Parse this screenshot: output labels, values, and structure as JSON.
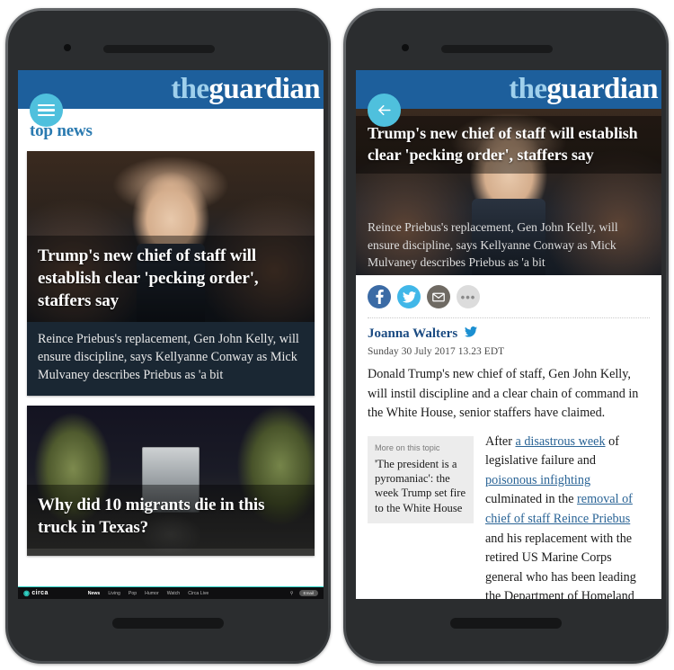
{
  "brand": {
    "logo_the": "the",
    "logo_guardian": "guardian",
    "accent": "#4fc0dd",
    "header_blue": "#1d5f9c"
  },
  "left_phone": {
    "menu_icon": "hamburger-menu-icon",
    "section_title": "top news",
    "cards": [
      {
        "headline": "Trump's new chief of staff will establish clear 'pecking order', staffers say",
        "standfirst": "Reince Priebus's replacement, Gen John Kelly, will ensure discipline, says Kellyanne Conway as Mick Mulvaney describes Priebus as 'a bit",
        "image_alt": "john-kelly-photo"
      },
      {
        "headline": "Why did 10 migrants die in this truck in Texas?",
        "standfirst": "",
        "image_alt": "truck-night-photo"
      }
    ],
    "circa_bar": {
      "logo": "circa",
      "nav": [
        "News",
        "Living",
        "Pop",
        "Humor",
        "Watch",
        "Circa Live"
      ],
      "active": "News",
      "search_icon": "search-icon",
      "button": "Email"
    }
  },
  "right_phone": {
    "back_icon": "back-arrow-icon",
    "headline": "Trump's new chief of staff will establish clear 'pecking order', staffers say",
    "standfirst": "Reince Priebus's replacement, Gen John Kelly, will ensure discipline, says Kellyanne Conway as Mick Mulvaney describes Priebus as 'a bit",
    "share": [
      {
        "name": "facebook-share-icon",
        "glyph": "f"
      },
      {
        "name": "twitter-share-icon",
        "glyph": ""
      },
      {
        "name": "email-share-icon",
        "glyph": ""
      },
      {
        "name": "more-share-icon",
        "glyph": "•••"
      }
    ],
    "author": "Joanna Walters",
    "author_twitter_icon": "twitter-bird-icon",
    "published": "Sunday 30 July 2017 13.23 EDT",
    "paragraph_1": "Donald Trump's new chief of staff, Gen John Kelly, will instil discipline and a clear chain of command in the White House, senior staffers have claimed.",
    "aside": {
      "label": "More on this topic",
      "link": "'The president is a pyromaniac': the week Trump set fire to the White House"
    },
    "paragraph_2": {
      "t1": "After ",
      "link1": "a disastrous week",
      "t2": " of legislative failure and ",
      "link2": "poisonous infighting",
      "t3": " culminated in the ",
      "link3": "removal of chief of staff Reince Priebus",
      "t4": " and his replacement with the retired US Marine Corps general who has been leading the Department of Homeland Security, Trump's adviser"
    }
  }
}
